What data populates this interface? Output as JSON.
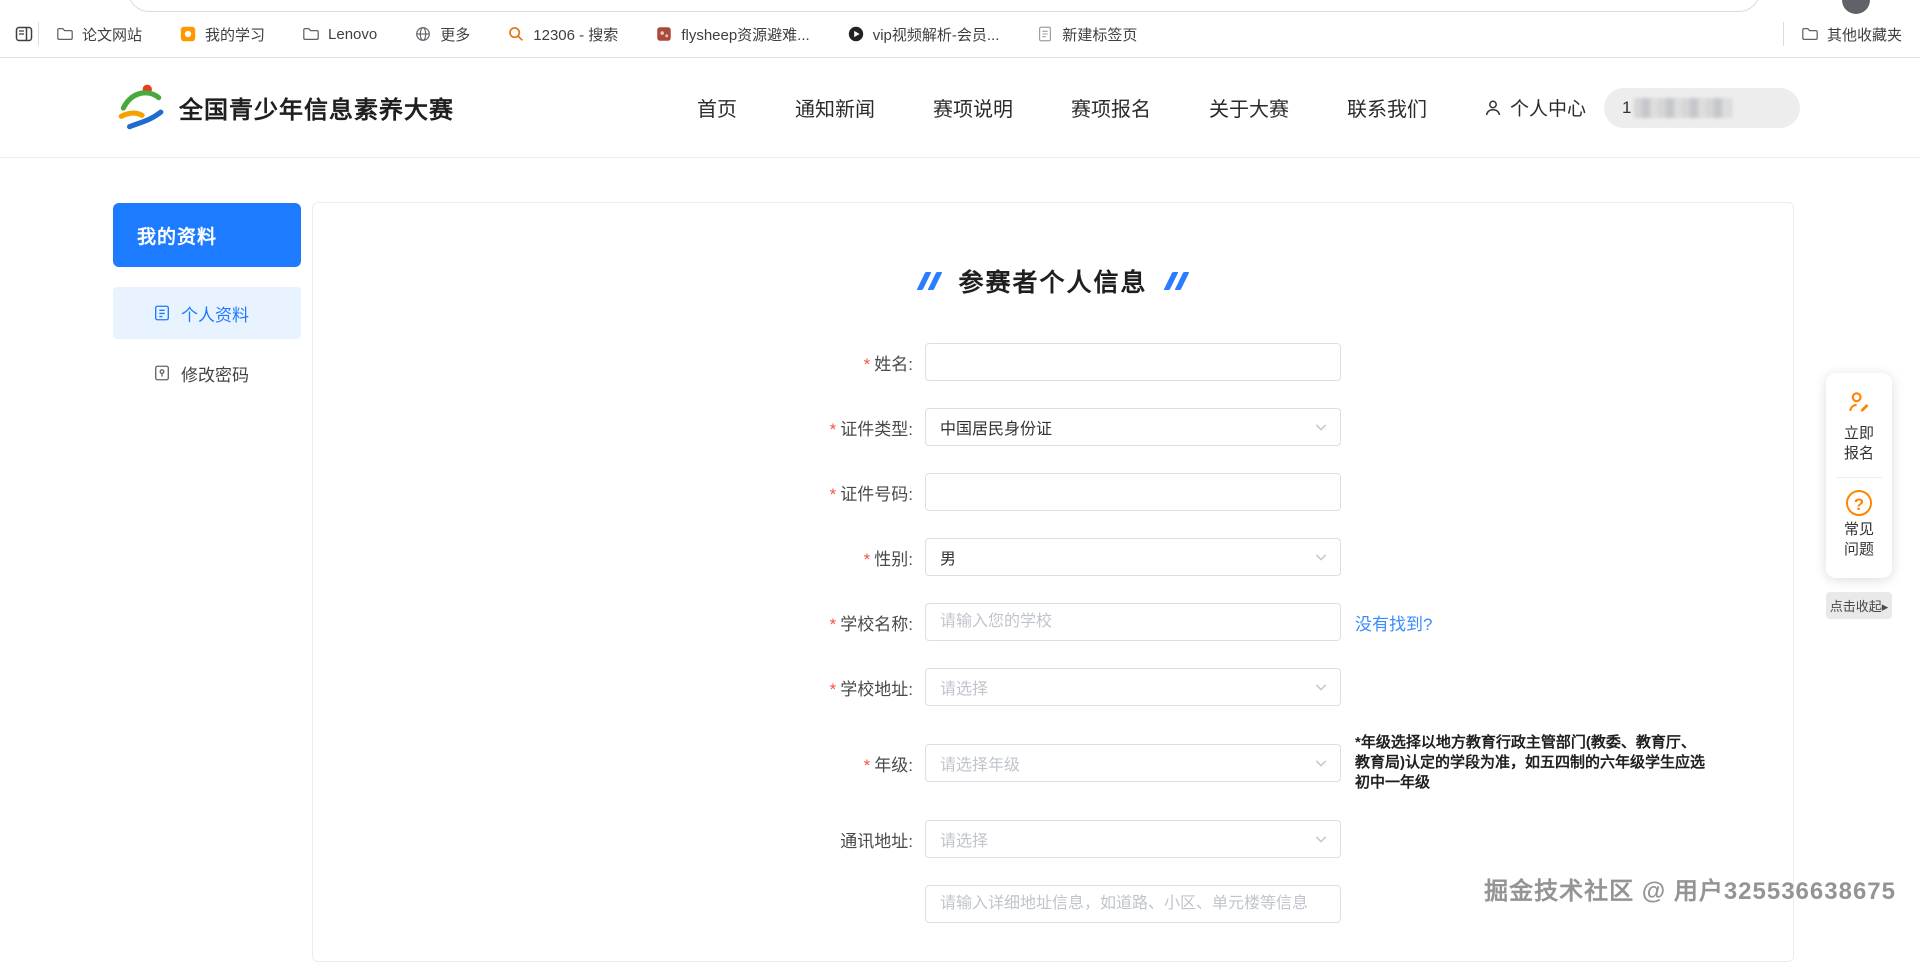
{
  "browser": {
    "bookmarks": [
      {
        "label": "论文网站",
        "icon": "folder-icon"
      },
      {
        "label": "我的学习",
        "icon": "orange-badge-icon"
      },
      {
        "label": "Lenovo",
        "icon": "folder-icon"
      },
      {
        "label": "更多",
        "icon": "globe-icon"
      },
      {
        "label": "12306 - 搜索",
        "icon": "search-icon"
      },
      {
        "label": "flysheep资源避难...",
        "icon": "red-site-icon"
      },
      {
        "label": "vip视频解析-会员...",
        "icon": "play-icon"
      },
      {
        "label": "新建标签页",
        "icon": "page-icon"
      }
    ],
    "other_bookmarks": "其他收藏夹"
  },
  "header": {
    "site_title": "全国青少年信息素养大赛",
    "nav": [
      "首页",
      "通知新闻",
      "赛项说明",
      "赛项报名",
      "关于大赛",
      "联系我们"
    ],
    "user_center": "个人中心",
    "phone_prefix": "1"
  },
  "sidebar": {
    "title": "我的资料",
    "items": [
      {
        "label": "个人资料"
      },
      {
        "label": "修改密码"
      }
    ]
  },
  "form": {
    "title": "参赛者个人信息",
    "required_mark": "*",
    "fields": {
      "name": {
        "label": "姓名:"
      },
      "id_type": {
        "label": "证件类型:",
        "value": "中国居民身份证"
      },
      "id_number": {
        "label": "证件号码:"
      },
      "gender": {
        "label": "性别:",
        "value": "男"
      },
      "school_name": {
        "label": "学校名称:",
        "placeholder": "请输入您的学校",
        "link": "没有找到?"
      },
      "school_address": {
        "label": "学校地址:",
        "placeholder": "请选择"
      },
      "grade": {
        "label": "年级:",
        "placeholder": "请选择年级",
        "note": "*年级选择以地方教育行政主管部门(教委、教育厅、教育局)认定的学段为准，如五四制的六年级学生应选初中一年级"
      },
      "mailing_address": {
        "label": "通讯地址:",
        "placeholder": "请选择"
      },
      "address_detail": {
        "placeholder": "请输入详细地址信息，如道路、小区、单元楼等信息"
      }
    }
  },
  "float_panel": {
    "register_line1": "立即",
    "register_line2": "报名",
    "faq_line1": "常见",
    "faq_line2": "问题",
    "faq_mark": "?",
    "collapse": "点击收起",
    "collapse_arrow": "▸"
  },
  "watermark": "掘金技术社区 @ 用户325536638675",
  "colors": {
    "accent_blue": "#1c7bff",
    "accent_orange": "#ff8400",
    "required_red": "#f25643",
    "link_blue": "#3b8cff"
  }
}
